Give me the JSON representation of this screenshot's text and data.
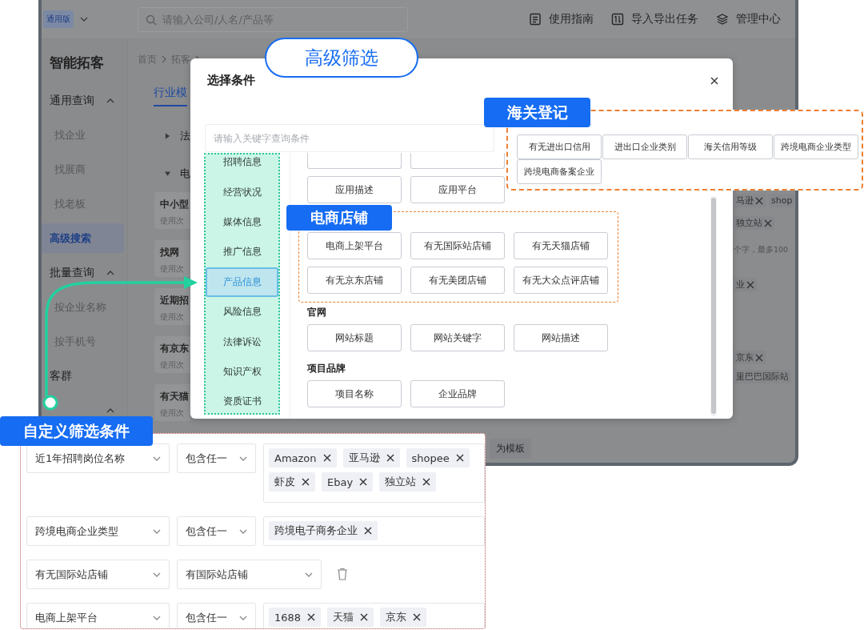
{
  "app": {
    "edition_badge": "通用版",
    "search": {
      "placeholder": "请输入公司/人名/产品等"
    },
    "toolbar": [
      {
        "label": "使用指南"
      },
      {
        "label": "导入导出任务"
      },
      {
        "label": "管理中心"
      }
    ]
  },
  "sidebar": {
    "title": "智能拓客",
    "groups": [
      {
        "label": "通用查询",
        "kind": "section",
        "expanded": true,
        "items": [
          {
            "label": "找企业",
            "selected": false
          },
          {
            "label": "找展商",
            "selected": false
          },
          {
            "label": "找老板",
            "selected": false
          },
          {
            "label": "高级搜索",
            "selected": true
          }
        ]
      },
      {
        "label": "批量查询",
        "kind": "section",
        "expanded": true,
        "items": [
          {
            "label": "按企业名称",
            "selected": false
          },
          {
            "label": "按手机号",
            "selected": false
          }
        ]
      },
      {
        "label": "客群",
        "kind": "link"
      },
      {
        "kind": "section",
        "expanded": true
      }
    ]
  },
  "breadcrumb": [
    "首页",
    "拓客"
  ],
  "content_tabs": [
    {
      "label": "行业模",
      "selected": true
    }
  ],
  "tree_rows": [
    {
      "label": "法",
      "expanded": false
    },
    {
      "label": "电",
      "expanded": true
    }
  ],
  "template_cards": [
    {
      "title": "中小型",
      "subtitle": "使用次"
    },
    {
      "title": "找网",
      "subtitle": "使用次"
    },
    {
      "title": "近期招",
      "subtitle": "使用次"
    },
    {
      "title": "有京东",
      "subtitle": "使用次"
    },
    {
      "title": "有天猫",
      "subtitle": "使用次"
    }
  ],
  "right_rows": [
    {
      "kind": "tags",
      "tags": [
        {
          "text": "马逊",
          "closable": true
        },
        {
          "text": "shop",
          "closable": false
        }
      ]
    },
    {
      "kind": "tags",
      "tags": [
        {
          "text": "独立站",
          "closable": true
        }
      ]
    },
    {
      "kind": "hint",
      "text": "个字，最多100"
    },
    {
      "kind": "tags",
      "tags": [
        {
          "text": "业",
          "closable": true
        }
      ]
    },
    {
      "kind": "tags",
      "tags": [
        {
          "text": "京东",
          "closable": true
        }
      ]
    },
    {
      "kind": "tags",
      "tags": [
        {
          "text": "里巴巴国际站",
          "closable": false
        }
      ]
    }
  ],
  "save_template_button": "为模板",
  "headline_badge": "高级筛选",
  "modal": {
    "title": "选择条件",
    "search": {
      "placeholder": "请输入关键字查询条件"
    },
    "categories": [
      {
        "label": "招聘信息",
        "selected": false
      },
      {
        "label": "经营状况",
        "selected": false
      },
      {
        "label": "媒体信息",
        "selected": false
      },
      {
        "label": "推广信息",
        "selected": false
      },
      {
        "label": "产品信息",
        "selected": true
      },
      {
        "label": "风险信息",
        "selected": false
      },
      {
        "label": "法律诉讼",
        "selected": false
      },
      {
        "label": "知识产权",
        "selected": false
      },
      {
        "label": "资质证书",
        "selected": false
      }
    ],
    "sections": [
      {
        "kind": "clipped",
        "options": [
          "应用描述",
          "应用平台"
        ]
      },
      {
        "kind": "highlighted",
        "callout": "电商店铺",
        "options": [
          "电商上架平台",
          "有无国际站店铺",
          "有无天猫店铺",
          "有无京东店铺",
          "有无美团店铺",
          "有无大众点评店铺"
        ]
      },
      {
        "kind": "plain",
        "title": "官网",
        "options": [
          "网站标题",
          "网站关键字",
          "网站描述"
        ]
      },
      {
        "kind": "plain",
        "title": "项目品牌",
        "options": [
          "项目名称",
          "企业品牌"
        ]
      }
    ]
  },
  "customs_callout": {
    "label": "海关登记",
    "options": [
      "有无进出口信用",
      "进出口企业类别",
      "海关信用等级",
      "跨境电商企业类型",
      "跨境电商备案企业"
    ]
  },
  "custom_filter": {
    "label": "自定义筛选条件",
    "rows": [
      {
        "kind": "tags",
        "field": "近1年招聘岗位名称",
        "operator": "包含任一",
        "tags": [
          "Amazon",
          "亚马逊",
          "shopee",
          "虾皮",
          "Ebay",
          "独立站"
        ]
      },
      {
        "kind": "tags",
        "field": "跨境电商企业类型",
        "operator": "包含任一",
        "tags": [
          "跨境电子商务企业"
        ]
      },
      {
        "kind": "select",
        "field": "有无国际站店铺",
        "value": "有国际站店铺"
      },
      {
        "kind": "tags",
        "field": "电商上架平台",
        "operator": "包含任一",
        "tags": [
          "1688",
          "天猫",
          "京东"
        ]
      }
    ]
  }
}
